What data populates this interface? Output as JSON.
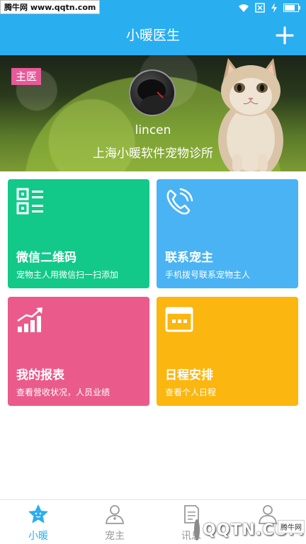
{
  "watermark": {
    "top": "腾牛网 www.qqtn.com",
    "bottom": "QQTN.COM",
    "bottom_tag": "腾牛网"
  },
  "header": {
    "title": "小暖医生"
  },
  "profile": {
    "role": "主医",
    "username": "lincen",
    "clinic": "上海小暖软件宠物诊所"
  },
  "cards": [
    {
      "title": "微信二维码",
      "subtitle": "宠物主人用微信扫一扫添加",
      "icon": "qr-code-icon",
      "color": "#12c98a"
    },
    {
      "title": "联系宠主",
      "subtitle": "手机拨号联系宠物主人",
      "icon": "phone-icon",
      "color": "#4ab3f4"
    },
    {
      "title": "我的报表",
      "subtitle": "查看营收状况，人员业绩",
      "icon": "bar-chart-icon",
      "color": "#ea5b8b"
    },
    {
      "title": "日程安排",
      "subtitle": "查看个人日程",
      "icon": "calendar-icon",
      "color": "#fbb60f"
    }
  ],
  "nav": {
    "items": [
      {
        "label": "小暖",
        "icon": "star-icon",
        "active": true
      },
      {
        "label": "宠主",
        "icon": "doctor-icon",
        "active": false
      },
      {
        "label": "讯息",
        "icon": "document-icon",
        "active": false
      },
      {
        "label": "",
        "icon": "person-icon",
        "active": false
      }
    ]
  },
  "colors": {
    "primary": "#29aef0",
    "badge": "#e75a9a"
  }
}
